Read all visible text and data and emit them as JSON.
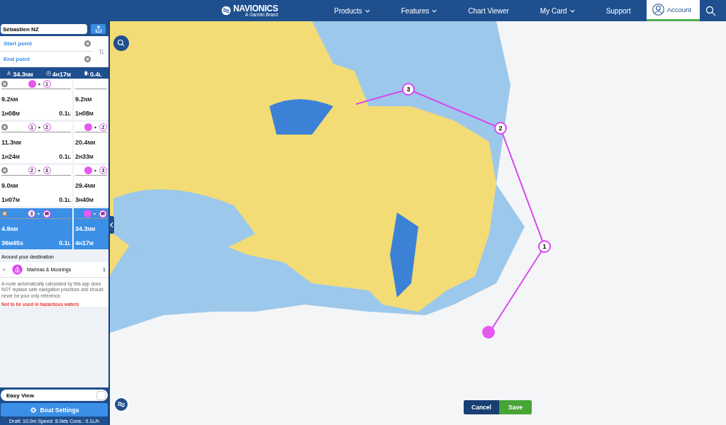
{
  "header": {
    "logo": "NAVIONICS",
    "logo_sub": "A Garmin Brand",
    "nav": [
      {
        "label": "Products",
        "dropdown": true,
        "selected": false
      },
      {
        "label": "Features",
        "dropdown": true,
        "selected": false
      },
      {
        "label": "Chart Viewer",
        "dropdown": false,
        "selected": false
      },
      {
        "label": "My Card",
        "dropdown": true,
        "selected": false
      },
      {
        "label": "Support",
        "dropdown": false,
        "selected": false
      },
      {
        "label": "Account",
        "dropdown": false,
        "selected": true
      }
    ]
  },
  "sidebar": {
    "route_name": "Sébastien NZ",
    "start_placeholder": "Start point",
    "end_placeholder": "End point",
    "summary": [
      {
        "kind": "distance",
        "value": "34.3",
        "unit": "NM"
      },
      {
        "kind": "time",
        "value": "4",
        "unit": "H",
        "value2": "17",
        "unit2": "M"
      },
      {
        "kind": "fuel",
        "value": "0.4",
        "unit": "L"
      }
    ],
    "legs": [
      {
        "selected": false,
        "from": {
          "kind": "start"
        },
        "to": {
          "kind": "number",
          "label": "1"
        },
        "distance": "9.2",
        "distance_unit": "NM",
        "fuel_unit": "L",
        "time": [
          [
            "1",
            "H"
          ],
          [
            "08",
            "M"
          ]
        ],
        "fuel": "0.1",
        "cum_distance": "9.2",
        "cum_distance_unit": "NM",
        "cum_time": [
          [
            "1",
            "H"
          ],
          [
            "08",
            "M"
          ]
        ]
      },
      {
        "selected": false,
        "from": {
          "kind": "number",
          "label": "1"
        },
        "to": {
          "kind": "number",
          "label": "2"
        },
        "distance": "11.3",
        "distance_unit": "NM",
        "fuel_unit": "L",
        "time": [
          [
            "1",
            "H"
          ],
          [
            "24",
            "M"
          ]
        ],
        "fuel": "0.1",
        "cum_from": {
          "kind": "start"
        },
        "cum_to": {
          "kind": "number",
          "label": "2"
        },
        "cum_distance": "20.4",
        "cum_distance_unit": "NM",
        "cum_time": [
          [
            "2",
            "H"
          ],
          [
            "33",
            "M"
          ]
        ]
      },
      {
        "selected": false,
        "from": {
          "kind": "number",
          "label": "2"
        },
        "to": {
          "kind": "number",
          "label": "3"
        },
        "distance": "9.0",
        "distance_unit": "NM",
        "fuel_unit": "L",
        "time": [
          [
            "1",
            "H"
          ],
          [
            "07",
            "M"
          ]
        ],
        "fuel": "0.1",
        "cum_from": {
          "kind": "start"
        },
        "cum_to": {
          "kind": "number",
          "label": "3"
        },
        "cum_distance": "29.4",
        "cum_distance_unit": "NM",
        "cum_time": [
          [
            "3",
            "H"
          ],
          [
            "40",
            "M"
          ]
        ]
      },
      {
        "selected": true,
        "from": {
          "kind": "number",
          "label": "3"
        },
        "to": {
          "kind": "end"
        },
        "distance": "4.9",
        "distance_unit": "NM",
        "fuel_unit": "L",
        "time": [
          [
            "36",
            "M"
          ],
          [
            "45",
            "S"
          ]
        ],
        "fuel": "0.1",
        "cum_from": {
          "kind": "start"
        },
        "cum_to": {
          "kind": "end"
        },
        "cum_distance": "34.3",
        "cum_distance_unit": "NM",
        "cum_time": [
          [
            "4",
            "H"
          ],
          [
            "17",
            "M"
          ]
        ]
      }
    ],
    "around_title": "Around your destination",
    "around_items": [
      {
        "label": "Marinas & Moorings",
        "count": "1",
        "expanded": false
      }
    ],
    "disclaimer": "A route automatically calculated by this app does NOT replace safe navigation practices and should never be your only reference.",
    "warning": "Not to be used in hazardous waters",
    "easy_view": {
      "label": "Easy View",
      "checked": false
    },
    "boat_settings": "Boat Settings",
    "boat_info": "Draft: 10.0m Speed: 8.0kts Cons.: 0.1L/h"
  },
  "map": {
    "waypoints": [
      {
        "label": "1"
      },
      {
        "label": "2"
      },
      {
        "label": "3"
      }
    ],
    "buttons": {
      "cancel": "Cancel",
      "save": "Save"
    }
  }
}
